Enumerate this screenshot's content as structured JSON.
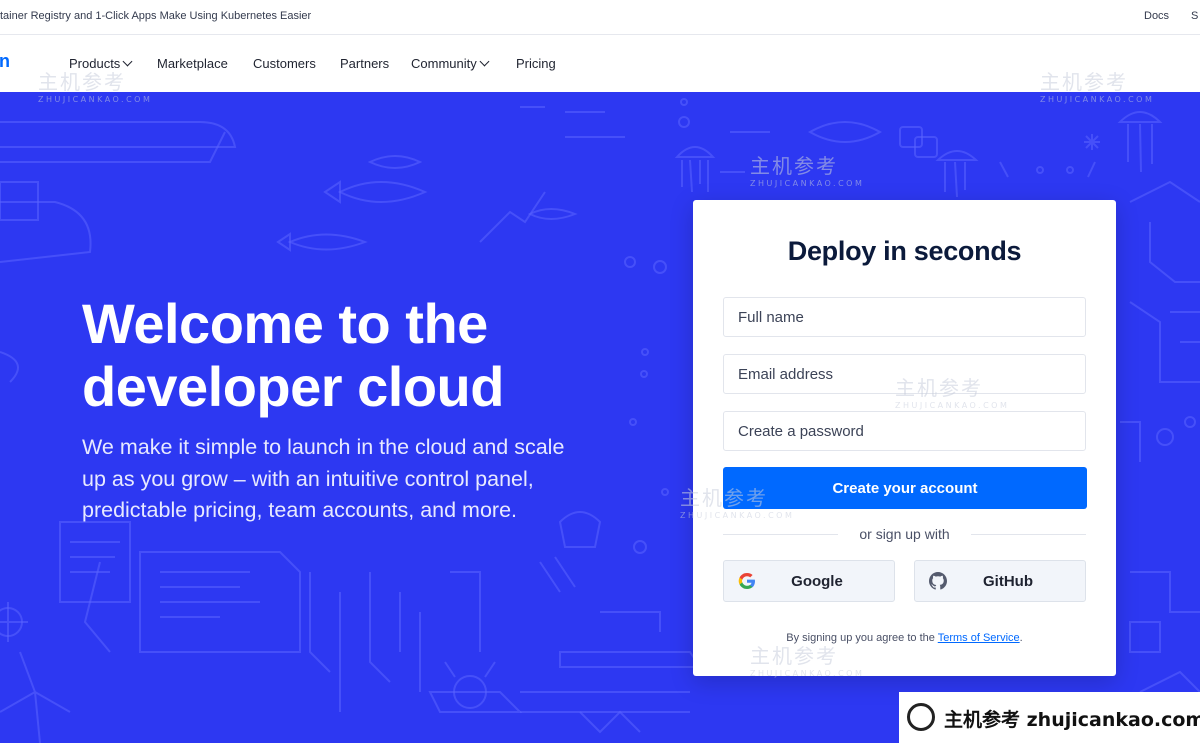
{
  "topbar": {
    "announcement": "tainer Registry and 1-Click Apps Make Using Kubernetes Easier",
    "docs_label": "Docs",
    "overflow_label": "S"
  },
  "nav": {
    "logo_fragment": "n",
    "items": [
      {
        "label": "Products",
        "dropdown": true
      },
      {
        "label": "Marketplace",
        "dropdown": false
      },
      {
        "label": "Customers",
        "dropdown": false
      },
      {
        "label": "Partners",
        "dropdown": false
      },
      {
        "label": "Community",
        "dropdown": true
      },
      {
        "label": "Pricing",
        "dropdown": false
      }
    ]
  },
  "hero": {
    "headline_line1": "Welcome to the",
    "headline_line2": "developer cloud",
    "subtext": "We make it simple to launch in the cloud and scale up as you grow – with an intuitive control panel, predictable pricing, team accounts, and more."
  },
  "signup": {
    "title": "Deploy in seconds",
    "full_name_placeholder": "Full name",
    "email_placeholder": "Email address",
    "password_placeholder": "Create a password",
    "submit_label": "Create your account",
    "or_text": "or sign up with",
    "google_label": "Google",
    "github_label": "GitHub",
    "terms_prefix": "By signing up you agree to the",
    "terms_link": "Terms of Service",
    "terms_suffix": "."
  },
  "watermark": {
    "text": "主机参考",
    "subtext": "ZHUJICANKAO.COM",
    "badge_text": "主机参考 zhujicankao.com"
  },
  "colors": {
    "hero_bg": "#2d38f2",
    "primary": "#0069ff",
    "heading": "#0b1a3b"
  }
}
